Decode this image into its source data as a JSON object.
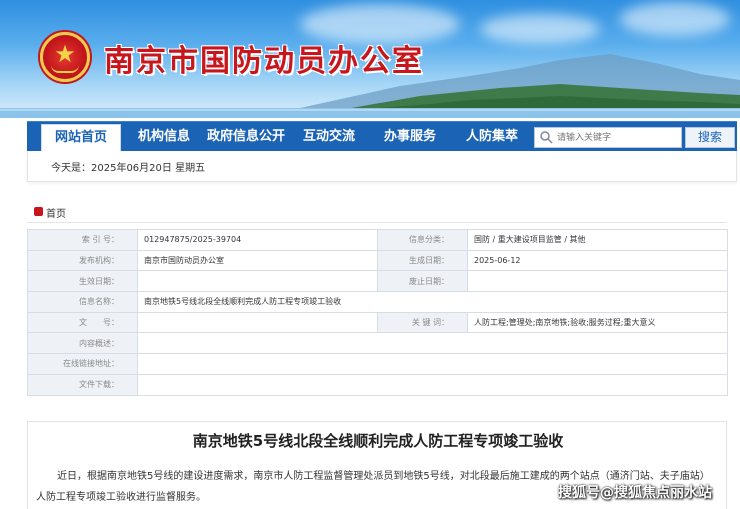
{
  "header": {
    "site_title": "南京市国防动员办公室"
  },
  "nav": {
    "home_label": "网站首页",
    "items": [
      "机构信息",
      "政府信息公开",
      "互动交流",
      "办事服务",
      "人防集萃"
    ],
    "search_placeholder": "请输入关键字",
    "search_button": "搜索"
  },
  "datebar": {
    "text": "今天是：2025年06月20日 星期五"
  },
  "breadcrumb": {
    "label": "首页"
  },
  "meta": {
    "rows": [
      {
        "l1": "索 引 号：",
        "v1": "012947875/2025-39704",
        "l2": "信息分类：",
        "v2": "国防 / 重大建设项目监管 / 其他"
      },
      {
        "l1": "发布机构：",
        "v1": "南京市国防动员办公室",
        "l2": "生成日期：",
        "v2": "2025-06-12"
      },
      {
        "l1": "生效日期：",
        "v1": "",
        "l2": "废止日期：",
        "v2": ""
      },
      {
        "l1": "信息名称：",
        "v1": "南京地铁5号线北段全线顺利完成人防工程专项竣工验收"
      },
      {
        "l1": "文　　号：",
        "v1": "",
        "l2": "关 键 词：",
        "v2": "人防工程;管理处;南京地铁;验收;服务过程;重大意义"
      },
      {
        "l1": "内容概述：",
        "v1": ""
      },
      {
        "l1": "在线链接地址：",
        "v1": ""
      },
      {
        "l1": "文件下载：",
        "v1": ""
      }
    ]
  },
  "article": {
    "title": "南京地铁5号线北段全线顺利完成人防工程专项竣工验收",
    "para1": "近日，根据南京地铁5号线的建设进度需求，南京市人防工程监督管理处派员到地铁5号线，对北段最后施工建成的两个站点（通济门站、夫子庙站）",
    "para2": "人防工程专项竣工验收进行监督服务。"
  },
  "watermark": "搜狐号@搜狐焦点丽水站",
  "colors": {
    "nav_blue": "#1b63b4",
    "title_red": "#c8161d",
    "label_bg": "#eef2f7"
  }
}
